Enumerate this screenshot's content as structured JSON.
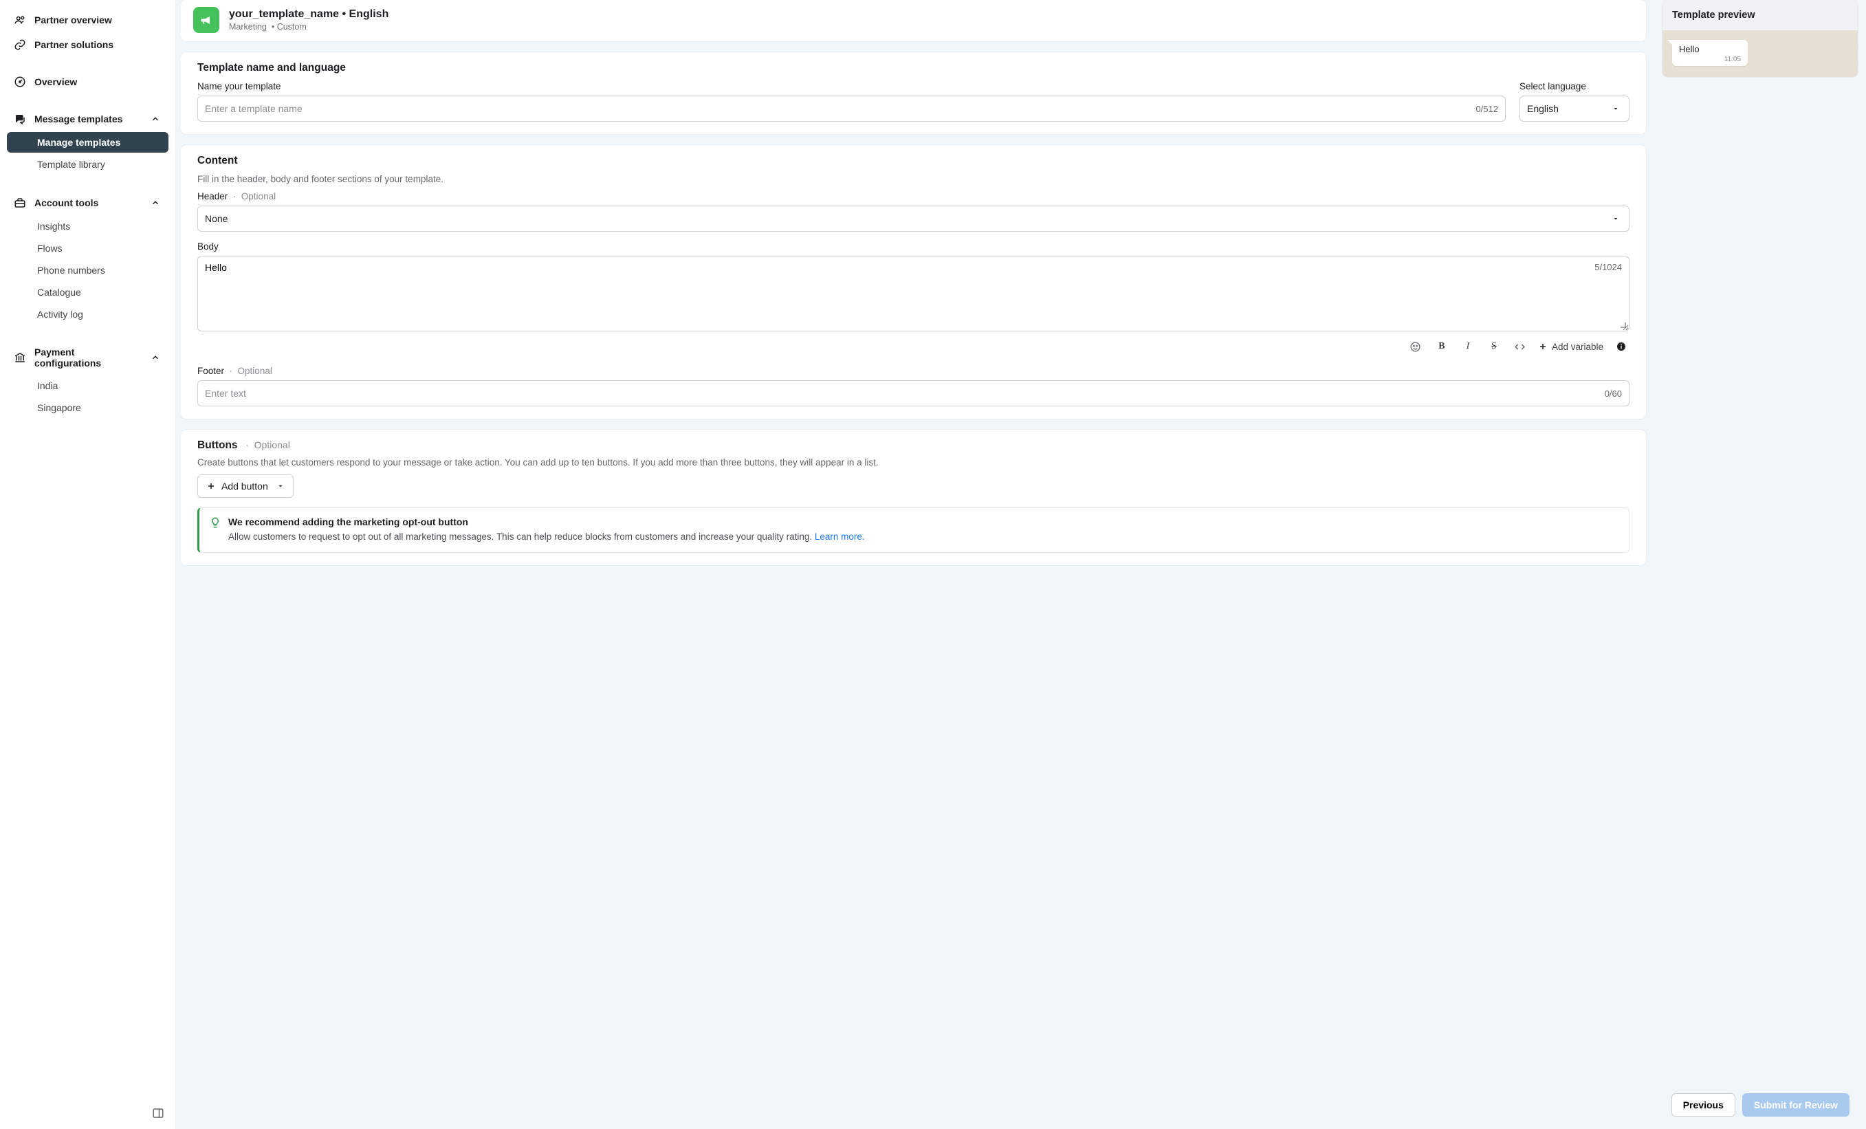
{
  "sidebar": {
    "top": [
      {
        "label": "Partner overview",
        "icon": "users-icon"
      },
      {
        "label": "Partner solutions",
        "icon": "link-icon"
      }
    ],
    "overview_label": "Overview",
    "msg_section": {
      "label": "Message templates",
      "items": [
        {
          "label": "Manage templates",
          "active": true
        },
        {
          "label": "Template library",
          "active": false
        }
      ]
    },
    "tools_section": {
      "label": "Account tools",
      "items": [
        "Insights",
        "Flows",
        "Phone numbers",
        "Catalogue",
        "Activity log"
      ]
    },
    "payment_section": {
      "label": "Payment configurations",
      "items": [
        "India",
        "Singapore"
      ]
    }
  },
  "header": {
    "title": "your_template_name • English",
    "category": "Marketing",
    "type": "Custom"
  },
  "name_section": {
    "title": "Template name and language",
    "name_label": "Name your template",
    "name_placeholder": "Enter a template name",
    "name_counter": "0/512",
    "lang_label": "Select language",
    "lang_value": "English"
  },
  "content_section": {
    "title": "Content",
    "desc": "Fill in the header, body and footer sections of your template.",
    "header_label": "Header",
    "optional_label": "Optional",
    "header_value": "None",
    "body_label": "Body",
    "body_value": "Hello",
    "body_counter": "5/1024",
    "add_variable_label": "Add variable",
    "footer_label": "Footer",
    "footer_placeholder": "Enter text",
    "footer_counter": "0/60"
  },
  "buttons_section": {
    "title": "Buttons",
    "optional_label": "Optional",
    "desc": "Create buttons that let customers respond to your message or take action. You can add up to ten buttons. If you add more than three buttons, they will appear in a list.",
    "add_button_label": "Add button",
    "callout_title": "We recommend adding the marketing opt-out button",
    "callout_desc": "Allow customers to request to opt out of all marketing messages. This can help reduce blocks from customers and increase your quality rating. ",
    "callout_link": "Learn more."
  },
  "preview": {
    "title": "Template preview",
    "bubble_text": "Hello",
    "bubble_time": "11:05"
  },
  "actions": {
    "previous": "Previous",
    "submit": "Submit for Review"
  }
}
